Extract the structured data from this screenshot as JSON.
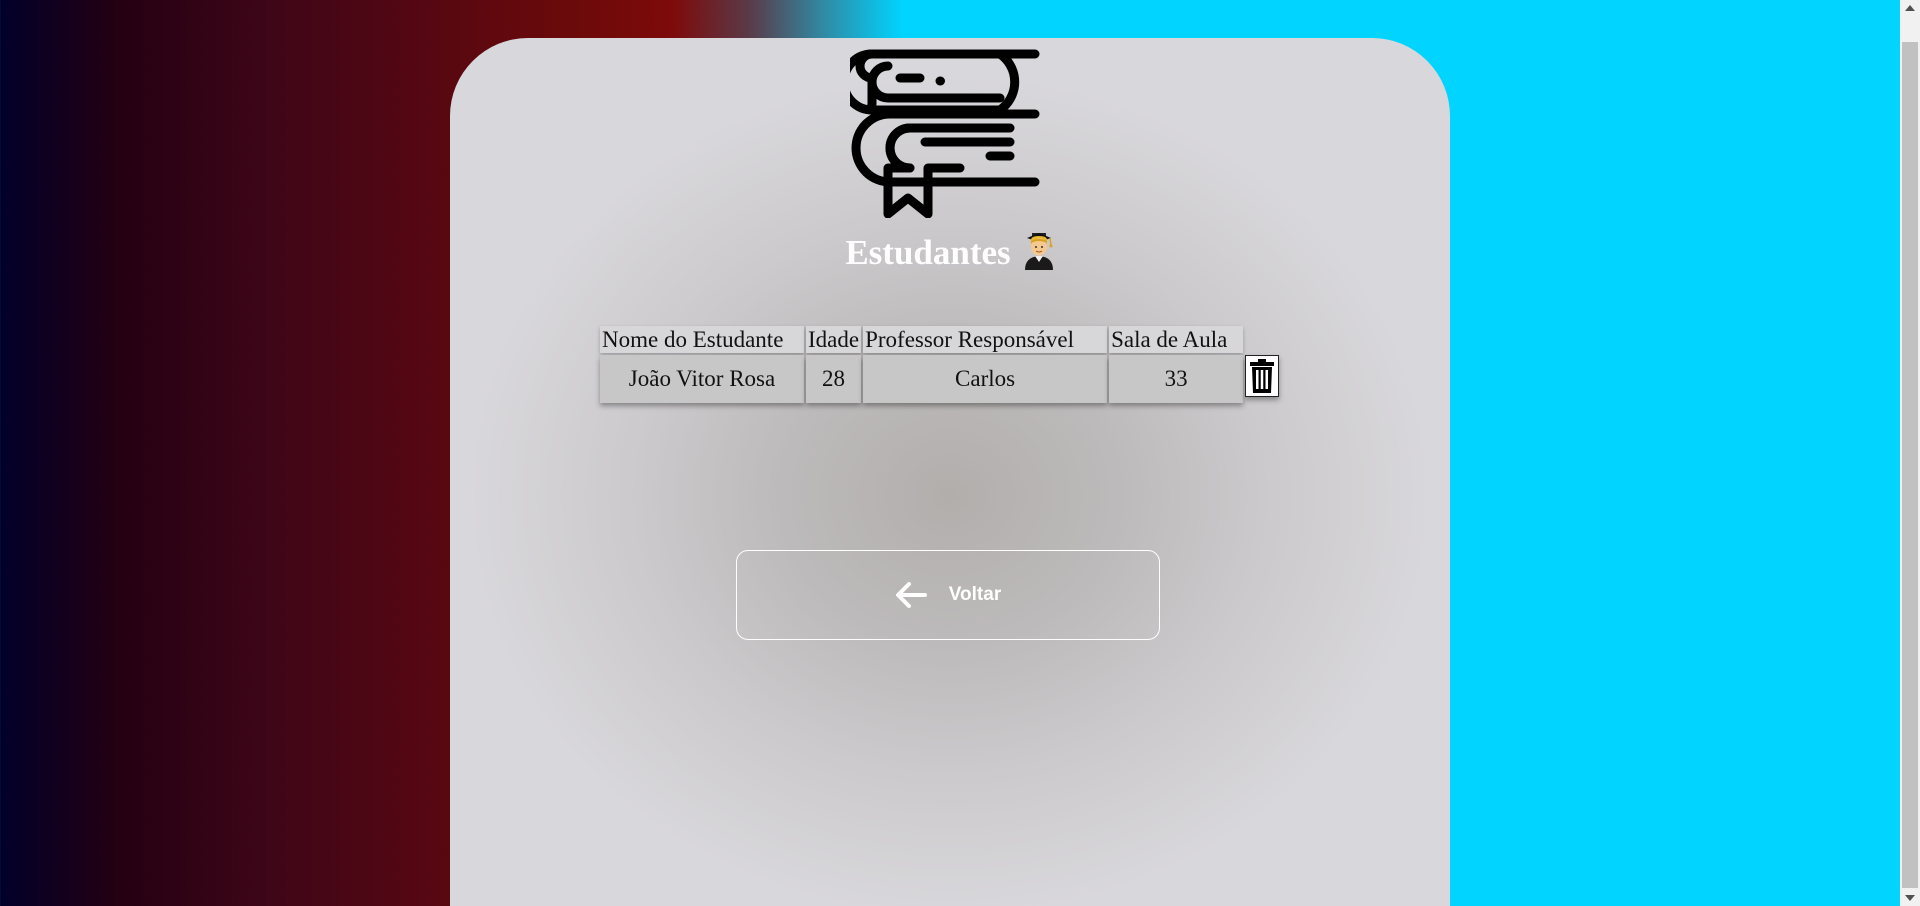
{
  "page": {
    "title": "Estudantes"
  },
  "logo": {
    "icon": "books-stack-icon"
  },
  "title_emoji": "graduate-emoji-icon",
  "table": {
    "headers": [
      "Nome do Estudante",
      "Idade",
      "Professor Responsável",
      "Sala de Aula"
    ],
    "rows": [
      {
        "name": "João Vitor Rosa",
        "age": "28",
        "teacher": "Carlos",
        "room": "33"
      }
    ],
    "delete_icon": "trash-icon"
  },
  "back_button": {
    "label": "Voltar",
    "icon": "arrow-left-icon"
  },
  "colors": {
    "background_left": "#01002a",
    "background_mid": "#7e0a0a",
    "background_right": "#00d4ff",
    "card": "#dcdbdf",
    "title_text": "#ffffff"
  }
}
